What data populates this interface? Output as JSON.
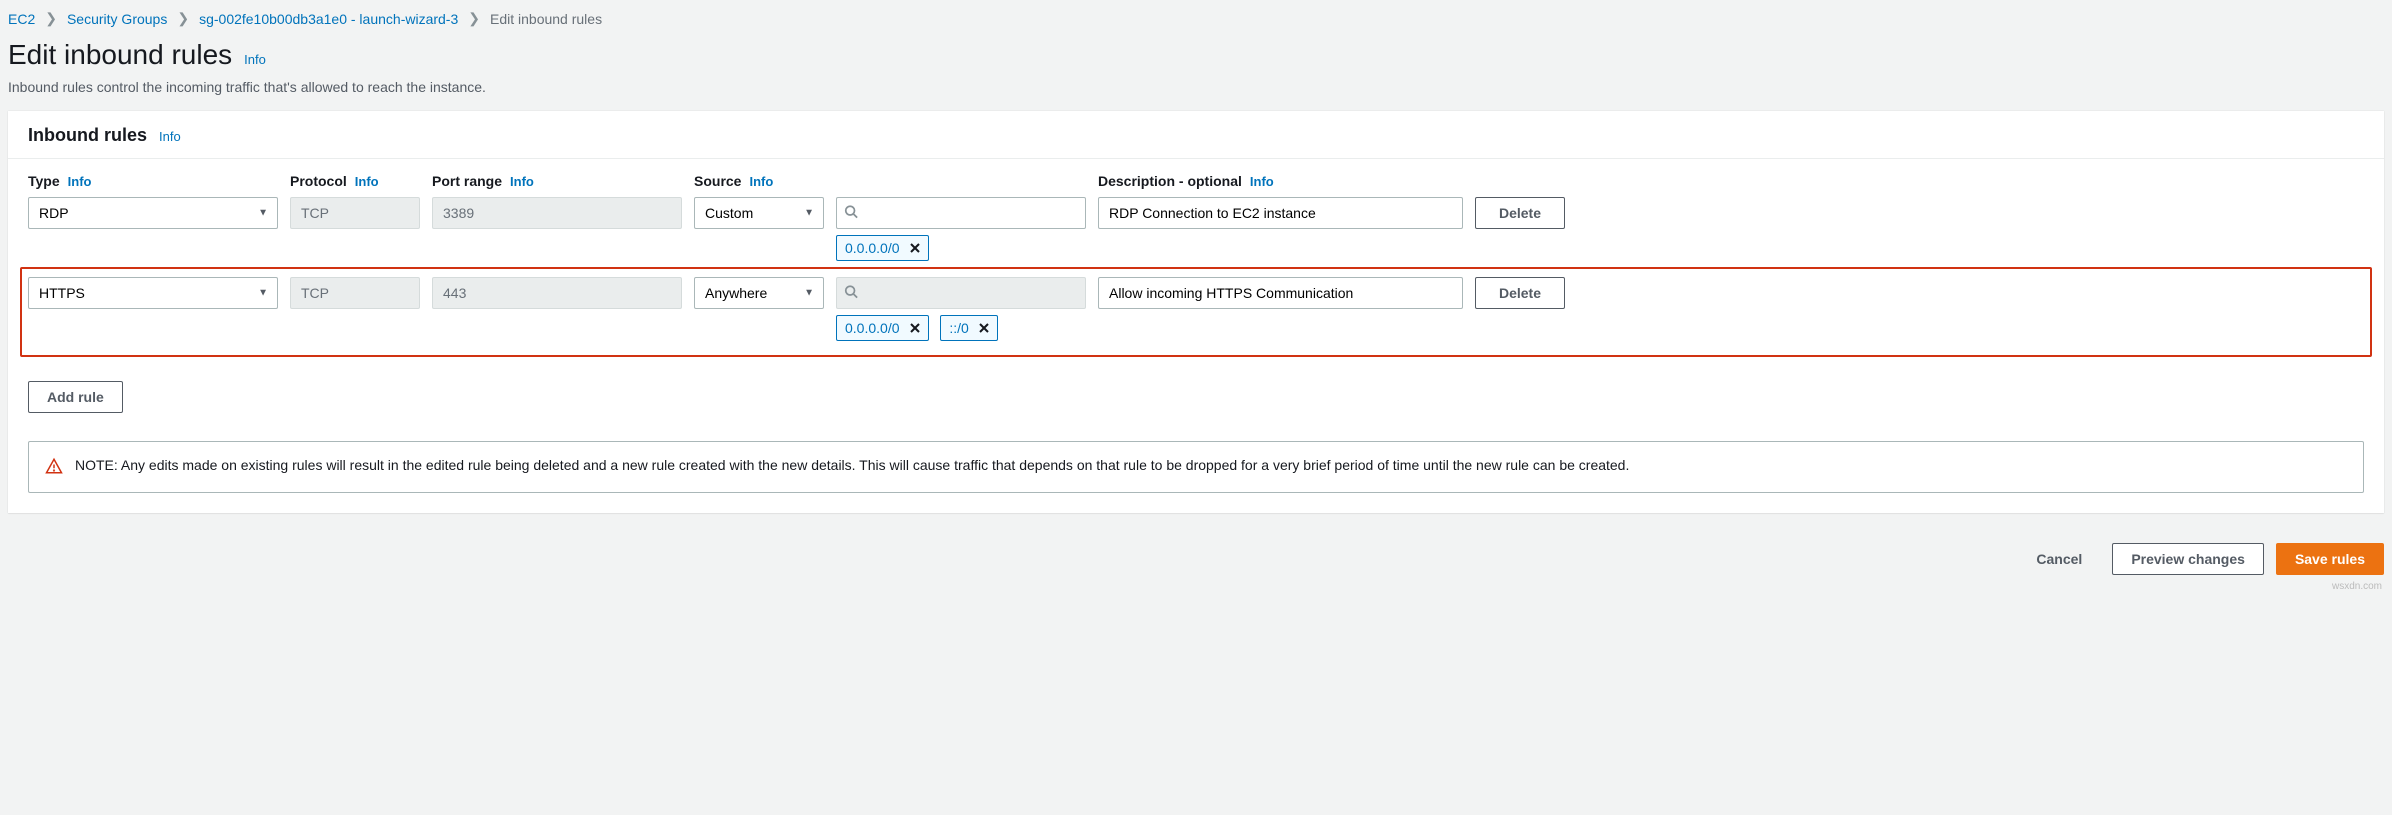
{
  "breadcrumb": {
    "ec2": "EC2",
    "sg": "Security Groups",
    "sg_detail": "sg-002fe10b00db3a1e0 - launch-wizard-3",
    "current": "Edit inbound rules"
  },
  "header": {
    "title": "Edit inbound rules",
    "info": "Info",
    "desc": "Inbound rules control the incoming traffic that's allowed to reach the instance."
  },
  "panel": {
    "title": "Inbound rules",
    "info": "Info"
  },
  "columns": {
    "type": "Type",
    "protocol": "Protocol",
    "port_range": "Port range",
    "source": "Source",
    "description": "Description - optional",
    "info": "Info"
  },
  "rules": [
    {
      "type": "RDP",
      "protocol": "TCP",
      "port": "3389",
      "source_mode": "Custom",
      "source_search": "",
      "cidrs": [
        "0.0.0.0/0"
      ],
      "description": "RDP Connection to EC2 instance",
      "highlight": false
    },
    {
      "type": "HTTPS",
      "protocol": "TCP",
      "port": "443",
      "source_mode": "Anywhere",
      "source_search": "",
      "cidrs": [
        "0.0.0.0/0",
        "::/0"
      ],
      "description": "Allow incoming HTTPS Communication",
      "highlight": true
    }
  ],
  "buttons": {
    "delete": "Delete",
    "add_rule": "Add rule",
    "cancel": "Cancel",
    "preview": "Preview changes",
    "save": "Save rules"
  },
  "alert": {
    "text": "NOTE: Any edits made on existing rules will result in the edited rule being deleted and a new rule created with the new details. This will cause traffic that depends on that rule to be dropped for a very brief period of time until the new rule can be created."
  },
  "credit": "wsxdn.com"
}
